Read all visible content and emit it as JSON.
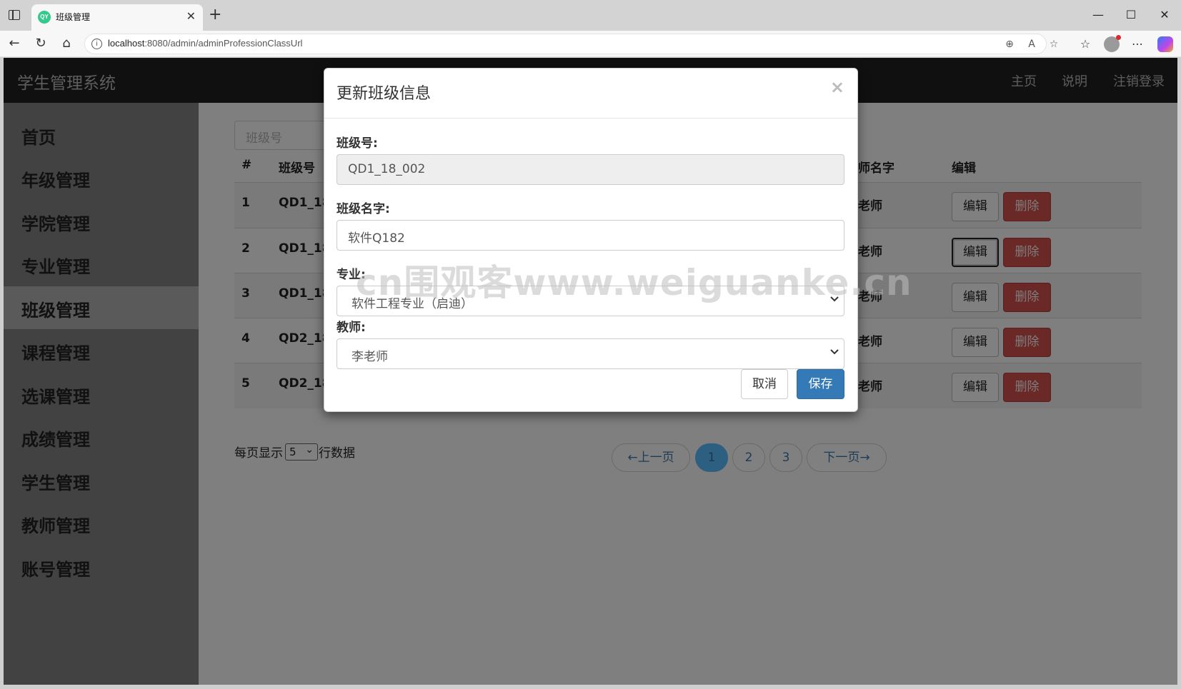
{
  "browser": {
    "tab_title": "班级管理",
    "favicon_text": "QY",
    "url_host": "localhost",
    "url_rest": ":8080/admin/adminProfessionClassUrl"
  },
  "navbar": {
    "brand": "学生管理系统",
    "links": [
      "主页",
      "说明",
      "注销登录"
    ]
  },
  "sidebar": {
    "items": [
      "首页",
      "年级管理",
      "学院管理",
      "专业管理",
      "班级管理",
      "课程管理",
      "选课管理",
      "成绩管理",
      "学生管理",
      "教师管理",
      "账号管理"
    ],
    "active": "班级管理"
  },
  "search": {
    "placeholder": "班级号"
  },
  "table": {
    "headers": {
      "index": "#",
      "class_no": "班级号",
      "teacher": "师名字",
      "edit": "编辑"
    },
    "rows": [
      {
        "index": "1",
        "class_no": "QD1_18",
        "teacher": "老师"
      },
      {
        "index": "2",
        "class_no": "QD1_18",
        "teacher": "老师"
      },
      {
        "index": "3",
        "class_no": "QD1_18",
        "teacher": "老师"
      },
      {
        "index": "4",
        "class_no": "QD2_18",
        "teacher": "老师"
      },
      {
        "index": "5",
        "class_no": "QD2_18",
        "teacher": "老师"
      }
    ],
    "edit_label": "编辑",
    "delete_label": "删除"
  },
  "pagination": {
    "page_size_prefix": "每页显示",
    "page_size_value": "5",
    "page_size_suffix": "行数据",
    "prev": "←上一页",
    "pages": [
      "1",
      "2",
      "3"
    ],
    "current": "1",
    "next": "下一页→"
  },
  "watermark": "cn围观客www.weiguanke.cn",
  "modal": {
    "title": "更新班级信息",
    "close": "×",
    "class_no_label": "班级号:",
    "class_no_value": "QD1_18_002",
    "class_name_label": "班级名字:",
    "class_name_value": "软件Q182",
    "major_label": "专业:",
    "major_value": "软件工程专业（启迪）",
    "teacher_label": "教师:",
    "teacher_value": "李老师",
    "cancel": "取消",
    "save": "保存"
  }
}
